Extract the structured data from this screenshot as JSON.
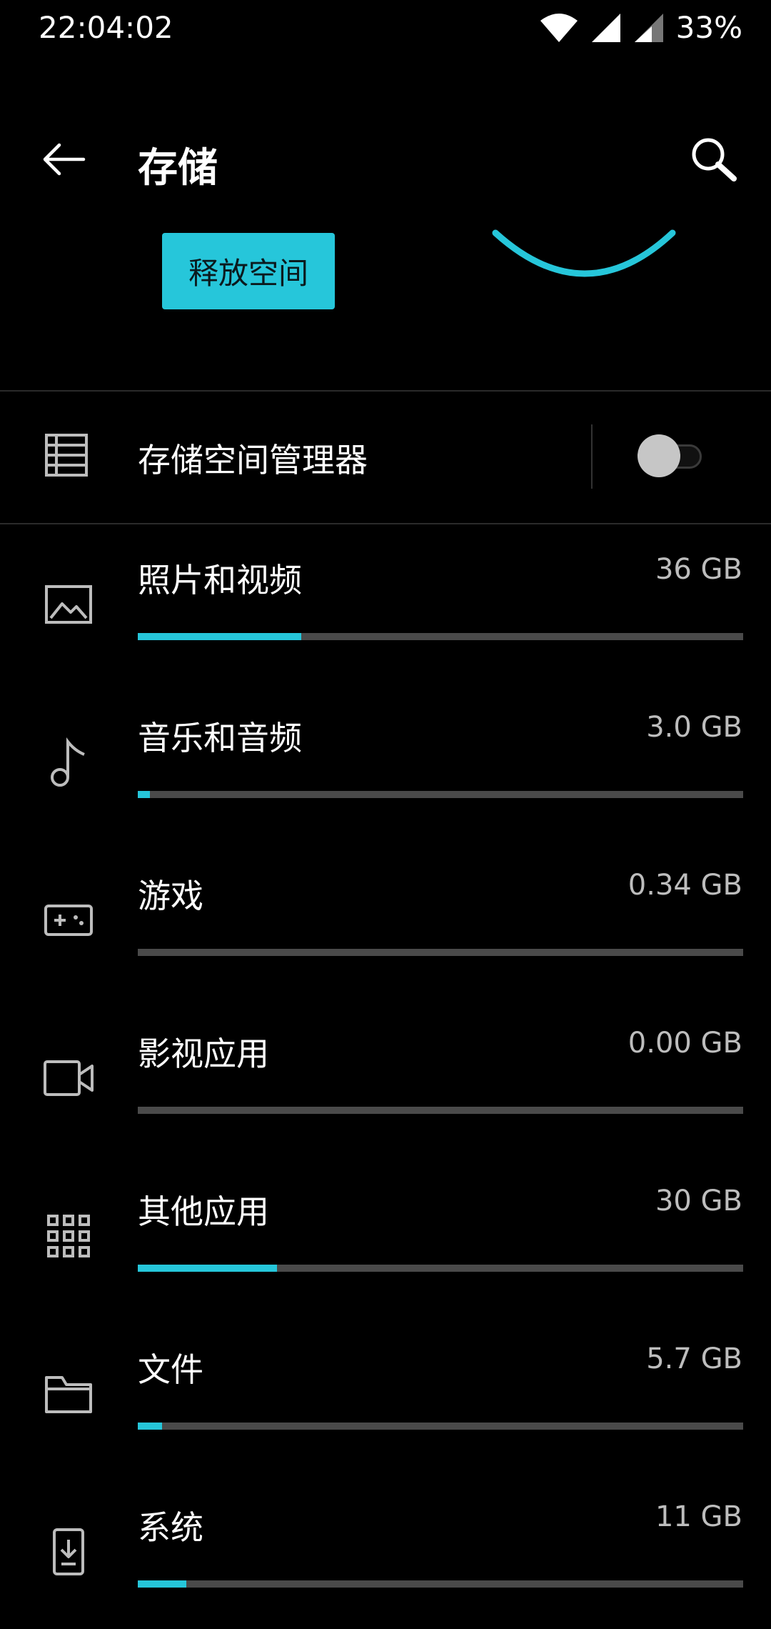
{
  "status_bar": {
    "time": "22:04:02",
    "battery": "33%",
    "icons": [
      "wifi-icon",
      "signal-icon",
      "signal-icon-2"
    ]
  },
  "app_bar": {
    "title": "存储",
    "back_icon": "back-arrow-icon",
    "search_icon": "search-icon"
  },
  "header": {
    "free_button_label": "释放空间",
    "accent_color": "#26c6da"
  },
  "storage_manager": {
    "label": "存储空间管理器",
    "icon": "storage-manager-icon",
    "toggle_on": false
  },
  "categories": [
    {
      "label": "照片和视频",
      "size": "36 GB",
      "usage": 0.27,
      "icon": "image-icon"
    },
    {
      "label": "音乐和音频",
      "size": "3.0 GB",
      "usage": 0.02,
      "icon": "music-note-icon"
    },
    {
      "label": "游戏",
      "size": "0.34 GB",
      "usage": 0.0,
      "icon": "gamepad-icon"
    },
    {
      "label": "影视应用",
      "size": "0.00 GB",
      "usage": 0.0,
      "icon": "video-camera-icon"
    },
    {
      "label": "其他应用",
      "size": "30 GB",
      "usage": 0.23,
      "icon": "apps-grid-icon"
    },
    {
      "label": "文件",
      "size": "5.7 GB",
      "usage": 0.04,
      "icon": "folder-icon"
    },
    {
      "label": "系统",
      "size": "11 GB",
      "usage": 0.08,
      "icon": "system-update-icon"
    }
  ]
}
